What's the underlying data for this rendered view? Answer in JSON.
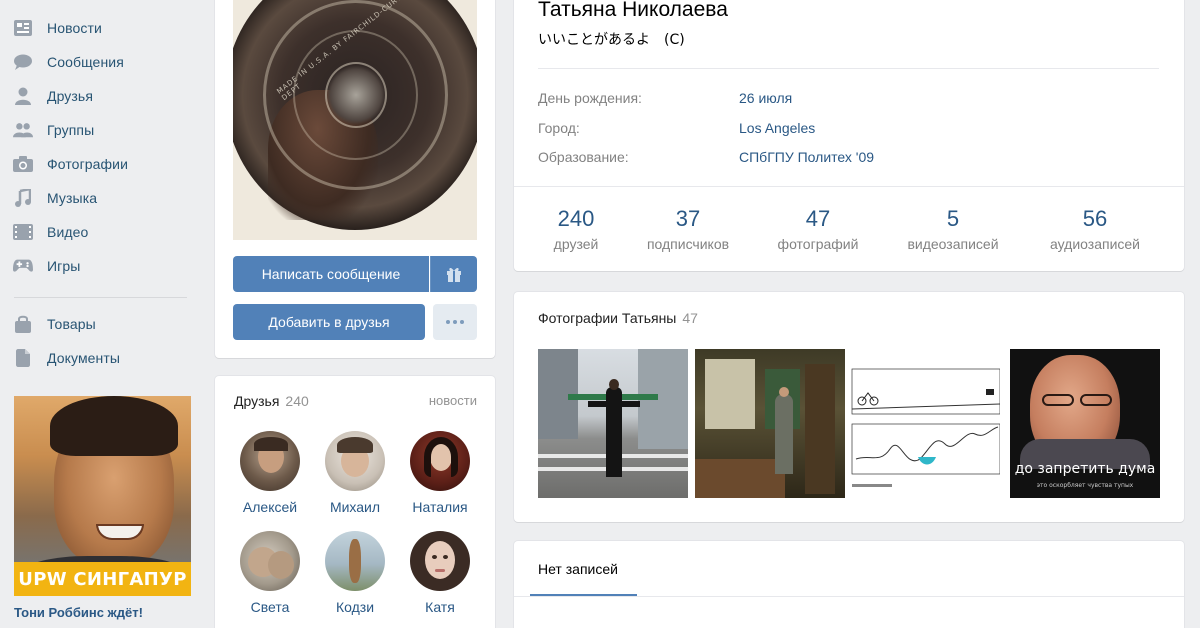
{
  "nav": {
    "items": [
      {
        "label": "Новости",
        "icon": "news-icon"
      },
      {
        "label": "Сообщения",
        "icon": "messages-icon"
      },
      {
        "label": "Друзья",
        "icon": "friends-icon"
      },
      {
        "label": "Группы",
        "icon": "groups-icon"
      },
      {
        "label": "Фотографии",
        "icon": "camera-icon"
      },
      {
        "label": "Музыка",
        "icon": "music-icon"
      },
      {
        "label": "Видео",
        "icon": "video-icon"
      },
      {
        "label": "Игры",
        "icon": "games-icon"
      },
      {
        "label": "Товары",
        "icon": "bag-icon"
      },
      {
        "label": "Документы",
        "icon": "document-icon"
      }
    ]
  },
  "ad": {
    "banner": "UPW СИНГАПУР",
    "title": "Тони Роббинс ждёт!"
  },
  "profile": {
    "name": "Татьяна Николаева",
    "status": "いいことがあるよ　(C)",
    "photo_text": "MADE IN U.S.A. BY FAIRCHILD-CURTIS OPTICAL DEPT",
    "rows": [
      {
        "label": "День рождения:",
        "value": "26 июля"
      },
      {
        "label": "Город:",
        "value": "Los Angeles"
      },
      {
        "label": "Образование:",
        "value": "СПбГПУ Политех '09"
      }
    ],
    "counters": [
      {
        "num": "240",
        "label": "друзей"
      },
      {
        "num": "37",
        "label": "подписчиков"
      },
      {
        "num": "47",
        "label": "фотографий"
      },
      {
        "num": "5",
        "label": "видеозаписей"
      },
      {
        "num": "56",
        "label": "аудиозаписей"
      }
    ]
  },
  "actions": {
    "message": "Написать сообщение",
    "add_friend": "Добавить в друзья"
  },
  "friends": {
    "title": "Друзья",
    "count": "240",
    "news_link": "новости",
    "list": [
      {
        "name": "Алексей"
      },
      {
        "name": "Михаил"
      },
      {
        "name": "Наталия"
      },
      {
        "name": "Света"
      },
      {
        "name": "Кодзи"
      },
      {
        "name": "Катя"
      }
    ]
  },
  "photos": {
    "title": "Фотографии Татьяны",
    "count": "47",
    "thumb4_caption": "до запретить дума",
    "thumb4_subcaption": "это оскорбляет чувства тупых"
  },
  "wall": {
    "tab": "Нет записей"
  },
  "colors": {
    "accent": "#5181b8",
    "link": "#2a5885",
    "background": "#edeef0"
  }
}
